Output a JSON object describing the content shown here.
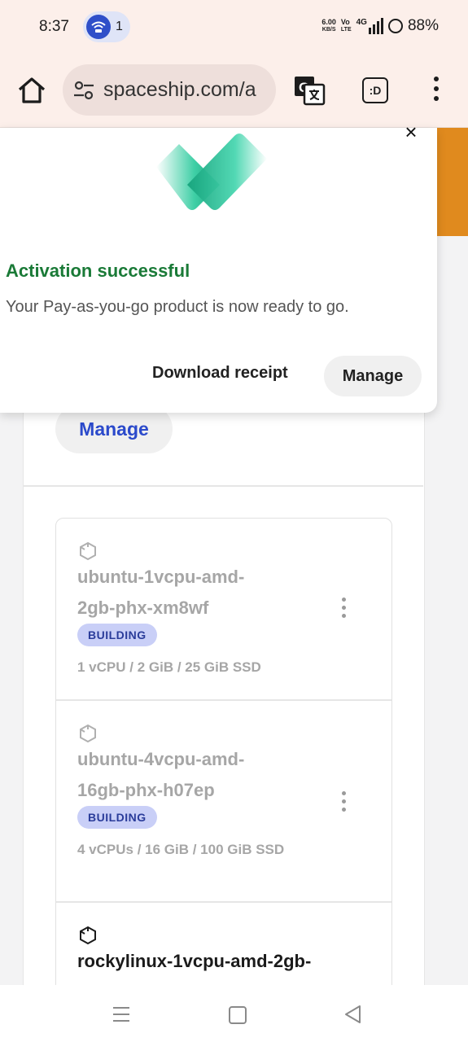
{
  "status_bar": {
    "time": "8:37",
    "hotspot_count": "1",
    "net_speed_value": "6.00",
    "net_speed_unit": "KB/S",
    "volte_top": "Vo",
    "volte_bottom": "LTE",
    "network": "4G",
    "battery": "88%"
  },
  "browser": {
    "url": "spaceship.com/a",
    "ext_label": ":D"
  },
  "popup": {
    "title": "Activation successful",
    "message": "Your Pay-as-you-go product is now ready to go.",
    "download_label": "Download receipt",
    "manage_label": "Manage",
    "close_label": "×"
  },
  "page": {
    "manage_label": "Manage"
  },
  "servers": [
    {
      "name_line1": "ubuntu-1vcpu-amd-",
      "name_line2": "2gb-phx-xm8wf",
      "status": "BUILDING",
      "specs": "1 vCPU / 2 GiB / 25 GiB SSD"
    },
    {
      "name_line1": "ubuntu-4vcpu-amd-",
      "name_line2": "16gb-phx-h07ep",
      "status": "BUILDING",
      "specs": "4 vCPUs / 16 GiB / 100 GiB SSD"
    },
    {
      "name_line1": "rockylinux-1vcpu-amd-2gb-"
    }
  ],
  "colors": {
    "accent_blue": "#2b4acb",
    "success_green": "#1a7a37",
    "badge_bg": "#c9cff7",
    "orange": "#e08a1e"
  }
}
